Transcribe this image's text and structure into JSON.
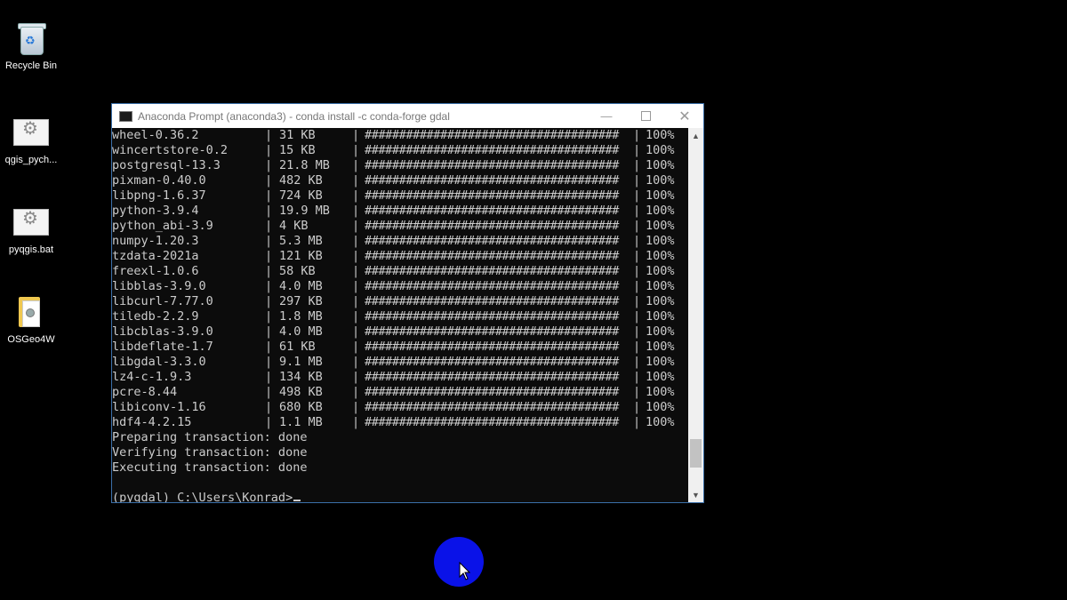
{
  "desktop": {
    "icons": [
      {
        "label": "Recycle Bin",
        "icon": "recycle-bin-icon"
      },
      {
        "label": "qgis_pych...",
        "icon": "batch-file-icon"
      },
      {
        "label": "pyqgis.bat",
        "icon": "batch-file-icon"
      },
      {
        "label": "OSGeo4W",
        "icon": "folder-icon"
      }
    ]
  },
  "window": {
    "title": "Anaconda Prompt (anaconda3) - conda  install -c conda-forge gdal",
    "minimize": "—",
    "close": "✕"
  },
  "console": {
    "packages": [
      {
        "name": "wheel-0.36.2",
        "size": "31 KB",
        "bar": "#####################################",
        "pct": "100%"
      },
      {
        "name": "wincertstore-0.2",
        "size": "15 KB",
        "bar": "#####################################",
        "pct": "100%"
      },
      {
        "name": "postgresql-13.3",
        "size": "21.8 MB",
        "bar": "#####################################",
        "pct": "100%"
      },
      {
        "name": "pixman-0.40.0",
        "size": "482 KB",
        "bar": "#####################################",
        "pct": "100%"
      },
      {
        "name": "libpng-1.6.37",
        "size": "724 KB",
        "bar": "#####################################",
        "pct": "100%"
      },
      {
        "name": "python-3.9.4",
        "size": "19.9 MB",
        "bar": "#####################################",
        "pct": "100%"
      },
      {
        "name": "python_abi-3.9",
        "size": "4 KB",
        "bar": "#####################################",
        "pct": "100%"
      },
      {
        "name": "numpy-1.20.3",
        "size": "5.3 MB",
        "bar": "#####################################",
        "pct": "100%"
      },
      {
        "name": "tzdata-2021a",
        "size": "121 KB",
        "bar": "#####################################",
        "pct": "100%"
      },
      {
        "name": "freexl-1.0.6",
        "size": "58 KB",
        "bar": "#####################################",
        "pct": "100%"
      },
      {
        "name": "libblas-3.9.0",
        "size": "4.0 MB",
        "bar": "#####################################",
        "pct": "100%"
      },
      {
        "name": "libcurl-7.77.0",
        "size": "297 KB",
        "bar": "#####################################",
        "pct": "100%"
      },
      {
        "name": "tiledb-2.2.9",
        "size": "1.8 MB",
        "bar": "#####################################",
        "pct": "100%"
      },
      {
        "name": "libcblas-3.9.0",
        "size": "4.0 MB",
        "bar": "#####################################",
        "pct": "100%"
      },
      {
        "name": "libdeflate-1.7",
        "size": "61 KB",
        "bar": "#####################################",
        "pct": "100%"
      },
      {
        "name": "libgdal-3.3.0",
        "size": "9.1 MB",
        "bar": "#####################################",
        "pct": "100%"
      },
      {
        "name": "lz4-c-1.9.3",
        "size": "134 KB",
        "bar": "#####################################",
        "pct": "100%"
      },
      {
        "name": "pcre-8.44",
        "size": "498 KB",
        "bar": "#####################################",
        "pct": "100%"
      },
      {
        "name": "libiconv-1.16",
        "size": "680 KB",
        "bar": "#####################################",
        "pct": "100%"
      },
      {
        "name": "hdf4-4.2.15",
        "size": "1.1 MB",
        "bar": "#####################################",
        "pct": "100%"
      }
    ],
    "separator": "|",
    "status_lines": [
      "Preparing transaction: done",
      "Verifying transaction: done",
      "Executing transaction: done"
    ],
    "prompt": "(pygdal) C:\\Users\\Konrad>"
  },
  "scrollbar": {
    "up": "▲",
    "down": "▼"
  }
}
